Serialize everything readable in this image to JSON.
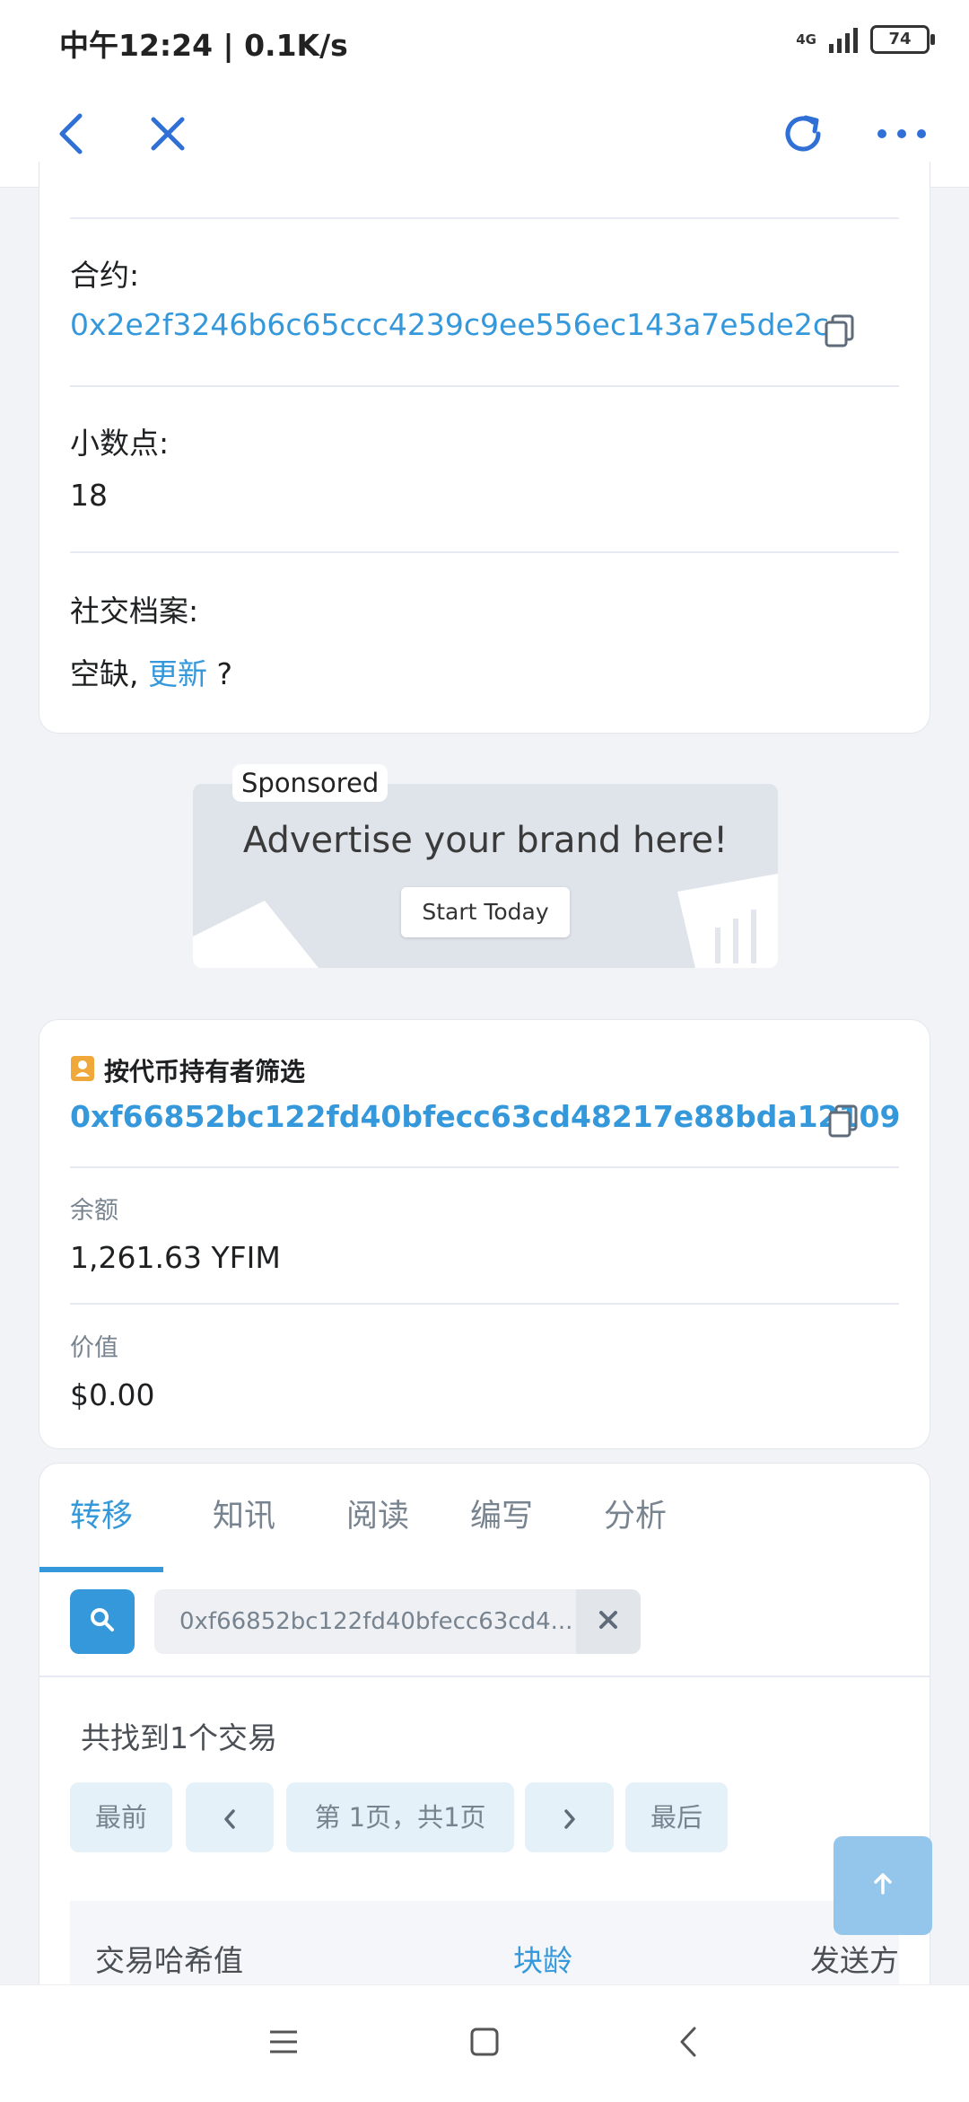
{
  "status": {
    "time": "中午12:24 | 0.1K/s",
    "network": "4G",
    "battery": "74"
  },
  "toolbar": {
    "back": "back",
    "close": "close",
    "reload": "reload",
    "more": "more"
  },
  "token_info": {
    "contract_label": "合约:",
    "contract_address": "0x2e2f3246b6c65ccc4239c9ee556ec143a7e5de2c",
    "decimals_label": "小数点:",
    "decimals_value": "18",
    "social_label": "社交档案:",
    "social_prefix": "空缺, ",
    "social_link": "更新",
    "social_suffix": " ?"
  },
  "ad": {
    "sponsored": "Sponsored",
    "headline": "Advertise your brand here!",
    "cta": "Start Today"
  },
  "holder_filter": {
    "title": "按代币持有者筛选",
    "address": "0xf66852bc122fd40bfecc63cd48217e88bda12109",
    "balance_label": "余额",
    "balance_value": "1,261.63 YFIM",
    "value_label": "价值",
    "value_value": "$0.00"
  },
  "tabs": {
    "items": [
      "转移",
      "知讯",
      "阅读",
      "编写",
      "分析"
    ],
    "active": "转移"
  },
  "search": {
    "value": "0xf66852bc122fd40bfecc63cd4..."
  },
  "results": {
    "count_text": "共找到1个交易"
  },
  "pagination": {
    "first": "最前",
    "page_text": "第 1页，共1页",
    "last": "最后"
  },
  "table": {
    "headers": [
      "交易哈希值",
      "块龄",
      "发送方"
    ]
  },
  "colors": {
    "accent": "#3498db",
    "badge": "#f0a83a"
  }
}
